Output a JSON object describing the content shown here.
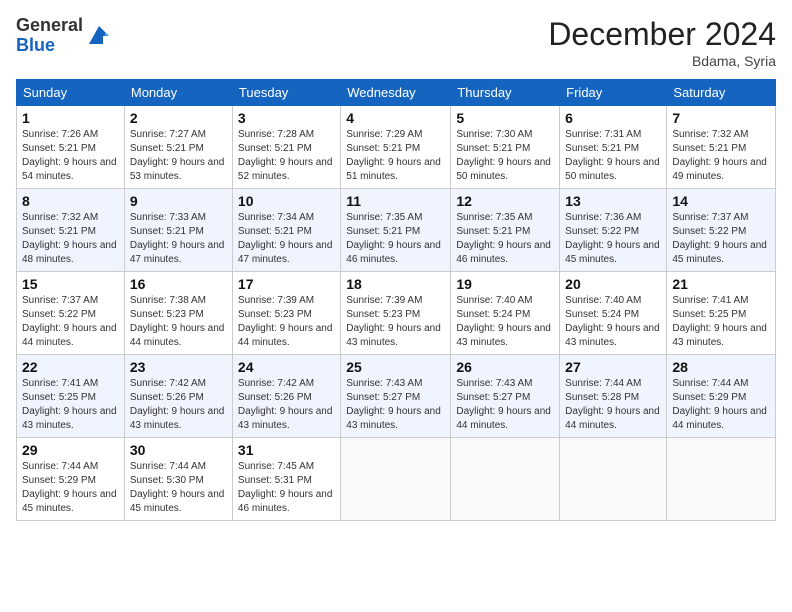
{
  "header": {
    "logo_line1": "General",
    "logo_line2": "Blue",
    "month": "December 2024",
    "location": "Bdama, Syria"
  },
  "days_of_week": [
    "Sunday",
    "Monday",
    "Tuesday",
    "Wednesday",
    "Thursday",
    "Friday",
    "Saturday"
  ],
  "weeks": [
    [
      {
        "day": "1",
        "sunrise": "7:26 AM",
        "sunset": "5:21 PM",
        "daylight": "9 hours and 54 minutes."
      },
      {
        "day": "2",
        "sunrise": "7:27 AM",
        "sunset": "5:21 PM",
        "daylight": "9 hours and 53 minutes."
      },
      {
        "day": "3",
        "sunrise": "7:28 AM",
        "sunset": "5:21 PM",
        "daylight": "9 hours and 52 minutes."
      },
      {
        "day": "4",
        "sunrise": "7:29 AM",
        "sunset": "5:21 PM",
        "daylight": "9 hours and 51 minutes."
      },
      {
        "day": "5",
        "sunrise": "7:30 AM",
        "sunset": "5:21 PM",
        "daylight": "9 hours and 50 minutes."
      },
      {
        "day": "6",
        "sunrise": "7:31 AM",
        "sunset": "5:21 PM",
        "daylight": "9 hours and 50 minutes."
      },
      {
        "day": "7",
        "sunrise": "7:32 AM",
        "sunset": "5:21 PM",
        "daylight": "9 hours and 49 minutes."
      }
    ],
    [
      {
        "day": "8",
        "sunrise": "7:32 AM",
        "sunset": "5:21 PM",
        "daylight": "9 hours and 48 minutes."
      },
      {
        "day": "9",
        "sunrise": "7:33 AM",
        "sunset": "5:21 PM",
        "daylight": "9 hours and 47 minutes."
      },
      {
        "day": "10",
        "sunrise": "7:34 AM",
        "sunset": "5:21 PM",
        "daylight": "9 hours and 47 minutes."
      },
      {
        "day": "11",
        "sunrise": "7:35 AM",
        "sunset": "5:21 PM",
        "daylight": "9 hours and 46 minutes."
      },
      {
        "day": "12",
        "sunrise": "7:35 AM",
        "sunset": "5:21 PM",
        "daylight": "9 hours and 46 minutes."
      },
      {
        "day": "13",
        "sunrise": "7:36 AM",
        "sunset": "5:22 PM",
        "daylight": "9 hours and 45 minutes."
      },
      {
        "day": "14",
        "sunrise": "7:37 AM",
        "sunset": "5:22 PM",
        "daylight": "9 hours and 45 minutes."
      }
    ],
    [
      {
        "day": "15",
        "sunrise": "7:37 AM",
        "sunset": "5:22 PM",
        "daylight": "9 hours and 44 minutes."
      },
      {
        "day": "16",
        "sunrise": "7:38 AM",
        "sunset": "5:23 PM",
        "daylight": "9 hours and 44 minutes."
      },
      {
        "day": "17",
        "sunrise": "7:39 AM",
        "sunset": "5:23 PM",
        "daylight": "9 hours and 44 minutes."
      },
      {
        "day": "18",
        "sunrise": "7:39 AM",
        "sunset": "5:23 PM",
        "daylight": "9 hours and 43 minutes."
      },
      {
        "day": "19",
        "sunrise": "7:40 AM",
        "sunset": "5:24 PM",
        "daylight": "9 hours and 43 minutes."
      },
      {
        "day": "20",
        "sunrise": "7:40 AM",
        "sunset": "5:24 PM",
        "daylight": "9 hours and 43 minutes."
      },
      {
        "day": "21",
        "sunrise": "7:41 AM",
        "sunset": "5:25 PM",
        "daylight": "9 hours and 43 minutes."
      }
    ],
    [
      {
        "day": "22",
        "sunrise": "7:41 AM",
        "sunset": "5:25 PM",
        "daylight": "9 hours and 43 minutes."
      },
      {
        "day": "23",
        "sunrise": "7:42 AM",
        "sunset": "5:26 PM",
        "daylight": "9 hours and 43 minutes."
      },
      {
        "day": "24",
        "sunrise": "7:42 AM",
        "sunset": "5:26 PM",
        "daylight": "9 hours and 43 minutes."
      },
      {
        "day": "25",
        "sunrise": "7:43 AM",
        "sunset": "5:27 PM",
        "daylight": "9 hours and 43 minutes."
      },
      {
        "day": "26",
        "sunrise": "7:43 AM",
        "sunset": "5:27 PM",
        "daylight": "9 hours and 44 minutes."
      },
      {
        "day": "27",
        "sunrise": "7:44 AM",
        "sunset": "5:28 PM",
        "daylight": "9 hours and 44 minutes."
      },
      {
        "day": "28",
        "sunrise": "7:44 AM",
        "sunset": "5:29 PM",
        "daylight": "9 hours and 44 minutes."
      }
    ],
    [
      {
        "day": "29",
        "sunrise": "7:44 AM",
        "sunset": "5:29 PM",
        "daylight": "9 hours and 45 minutes."
      },
      {
        "day": "30",
        "sunrise": "7:44 AM",
        "sunset": "5:30 PM",
        "daylight": "9 hours and 45 minutes."
      },
      {
        "day": "31",
        "sunrise": "7:45 AM",
        "sunset": "5:31 PM",
        "daylight": "9 hours and 46 minutes."
      },
      null,
      null,
      null,
      null
    ]
  ]
}
